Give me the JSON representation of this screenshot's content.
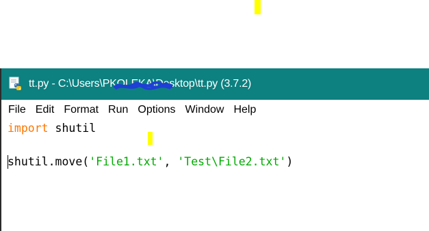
{
  "window": {
    "title": "tt.py - C:\\Users\\PKOLEKA\\Desktop\\tt.py (3.7.2)",
    "title_prefix": "tt.py - C:\\Users\\",
    "title_redacted": "PKOLEKA",
    "title_suffix": "\\Desktop\\tt.py (3.7.2)",
    "icon": "python-idle-icon",
    "titlebar_color": "#0d8080"
  },
  "menu": {
    "items": [
      "File",
      "Edit",
      "Format",
      "Run",
      "Options",
      "Window",
      "Help"
    ]
  },
  "editor": {
    "line1": {
      "keyword": "import",
      "rest": " shutil"
    },
    "line2": "",
    "line3": {
      "prefix": "shutil.move(",
      "arg1": "'File1.txt'",
      "sep": ", ",
      "arg2": "'Test\\File2.txt'",
      "suffix": ")"
    },
    "keyword_color": "#ff7700",
    "string_color": "#00aa00"
  },
  "annotations": {
    "highlight_color": "#ffff00"
  }
}
